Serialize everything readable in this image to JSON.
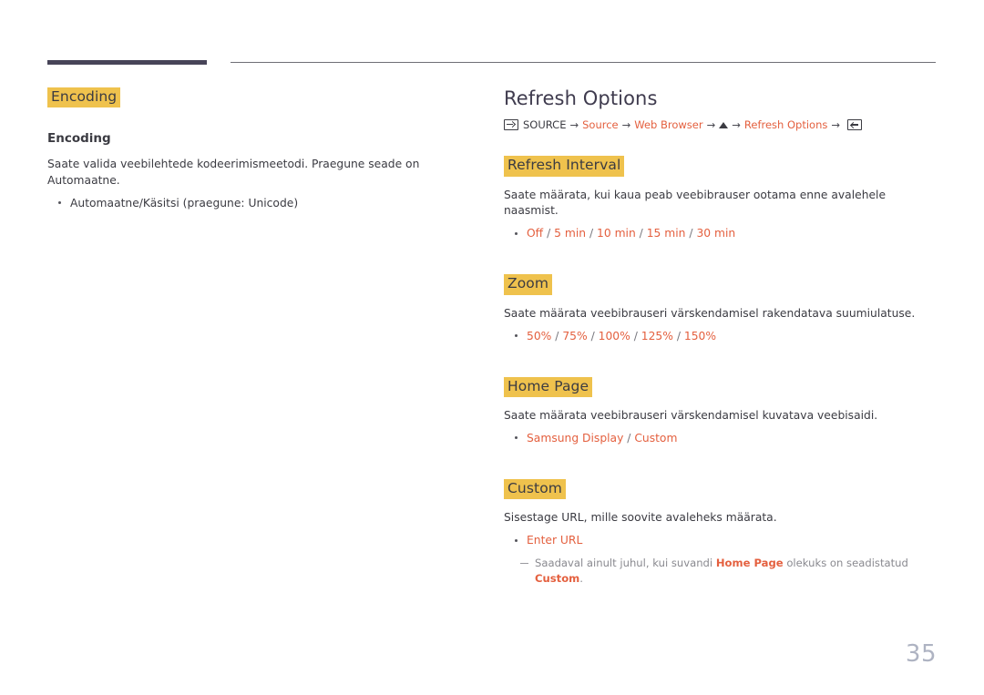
{
  "document": {
    "page_number": "35",
    "accent_highlight": "#efc24d",
    "accent_link": "#e4603f",
    "rule_color": "#474458"
  },
  "left_column": {
    "section_heading": "Encoding",
    "sub_heading": "Encoding",
    "description": "Saate valida veebilehtede kodeerimismeetodi. Praegune seade on Automaatne.",
    "bullets": [
      {
        "text": "Automaatne/Käsitsi (praegune: Unicode)"
      }
    ]
  },
  "right_column": {
    "title": "Refresh Options",
    "breadcrumb": {
      "source_icon": "source-input-icon",
      "source_label": "SOURCE",
      "arrow": "→",
      "items": [
        {
          "label": "Source",
          "type": "link"
        },
        {
          "label": "Web Browser",
          "type": "link"
        },
        {
          "label": "up-triangle-icon",
          "type": "icon"
        },
        {
          "label": "Refresh Options",
          "type": "link"
        }
      ],
      "enter_icon": "enter-key-icon"
    },
    "sections": [
      {
        "heading": "Refresh Interval",
        "description": "Saate määrata, kui kaua peab veebibrauser ootama enne avalehele naasmist.",
        "options_prefix": "",
        "options": [
          "Off",
          "5 min",
          "10 min",
          "15 min",
          "30 min"
        ],
        "separator": " / "
      },
      {
        "heading": "Zoom",
        "description": "Saate määrata veebibrauseri värskendamisel rakendatava suumiulatuse.",
        "options": [
          "50%",
          "75%",
          "100%",
          "125%",
          "150%"
        ],
        "separator": " / "
      },
      {
        "heading": "Home Page",
        "description": "Saate määrata veebibrauseri värskendamisel kuvatava veebisaidi.",
        "options": [
          "Samsung Display",
          "Custom"
        ],
        "separator": " / "
      },
      {
        "heading": "Custom",
        "description": "Sisestage URL, mille soovite avaleheks määrata.",
        "options": [
          "Enter URL"
        ],
        "separator": " / ",
        "note": {
          "part1": "Saadaval ainult juhul, kui suvandi ",
          "strong1": "Home Page",
          "part2": " olekuks on seadistatud ",
          "strong2": "Custom",
          "part3": "."
        }
      }
    ]
  }
}
